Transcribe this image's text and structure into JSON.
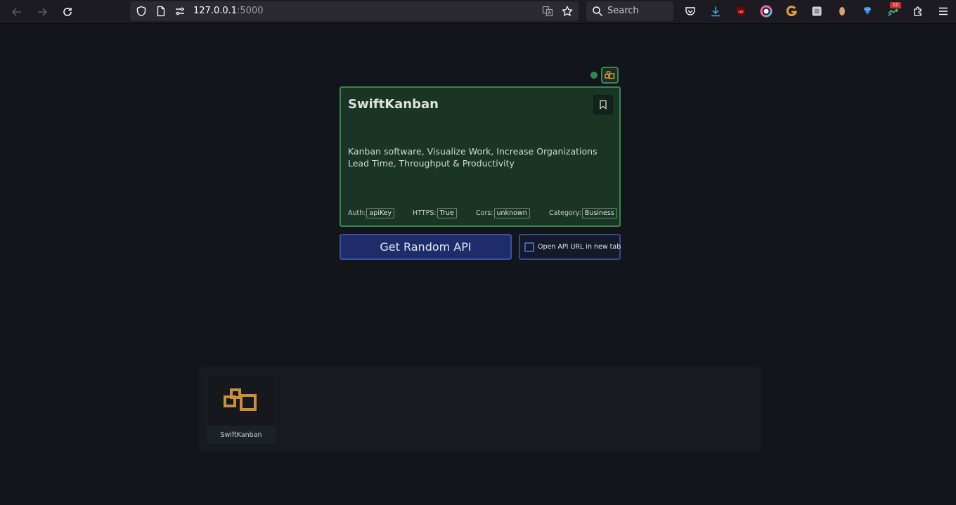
{
  "browser": {
    "url_host": "127.0.0.1",
    "url_port": ":5000",
    "search_placeholder": "Search",
    "notification_count": "10"
  },
  "card": {
    "title": "SwiftKanban",
    "description": "Kanban software, Visualize Work, Increase Organizations Lead Time, Throughput & Productivity",
    "auth_label": "Auth:",
    "auth_value": "apiKey",
    "https_label": "HTTPS:",
    "https_value": "True",
    "cors_label": "Cors:",
    "cors_value": "unknown",
    "category_label": "Category:",
    "category_value": "Business"
  },
  "actions": {
    "random_button": "Get Random API",
    "new_tab_label": "Open API URL in new tab",
    "new_tab_checked": false
  },
  "history": {
    "items": [
      {
        "label": "SwiftKanban"
      }
    ]
  },
  "colors": {
    "card_bg": "#1a3524",
    "card_border": "#3a8452",
    "button_bg": "#1f2c6a",
    "logo_gold": "#d19a3c",
    "status_green": "#2f8a52"
  }
}
